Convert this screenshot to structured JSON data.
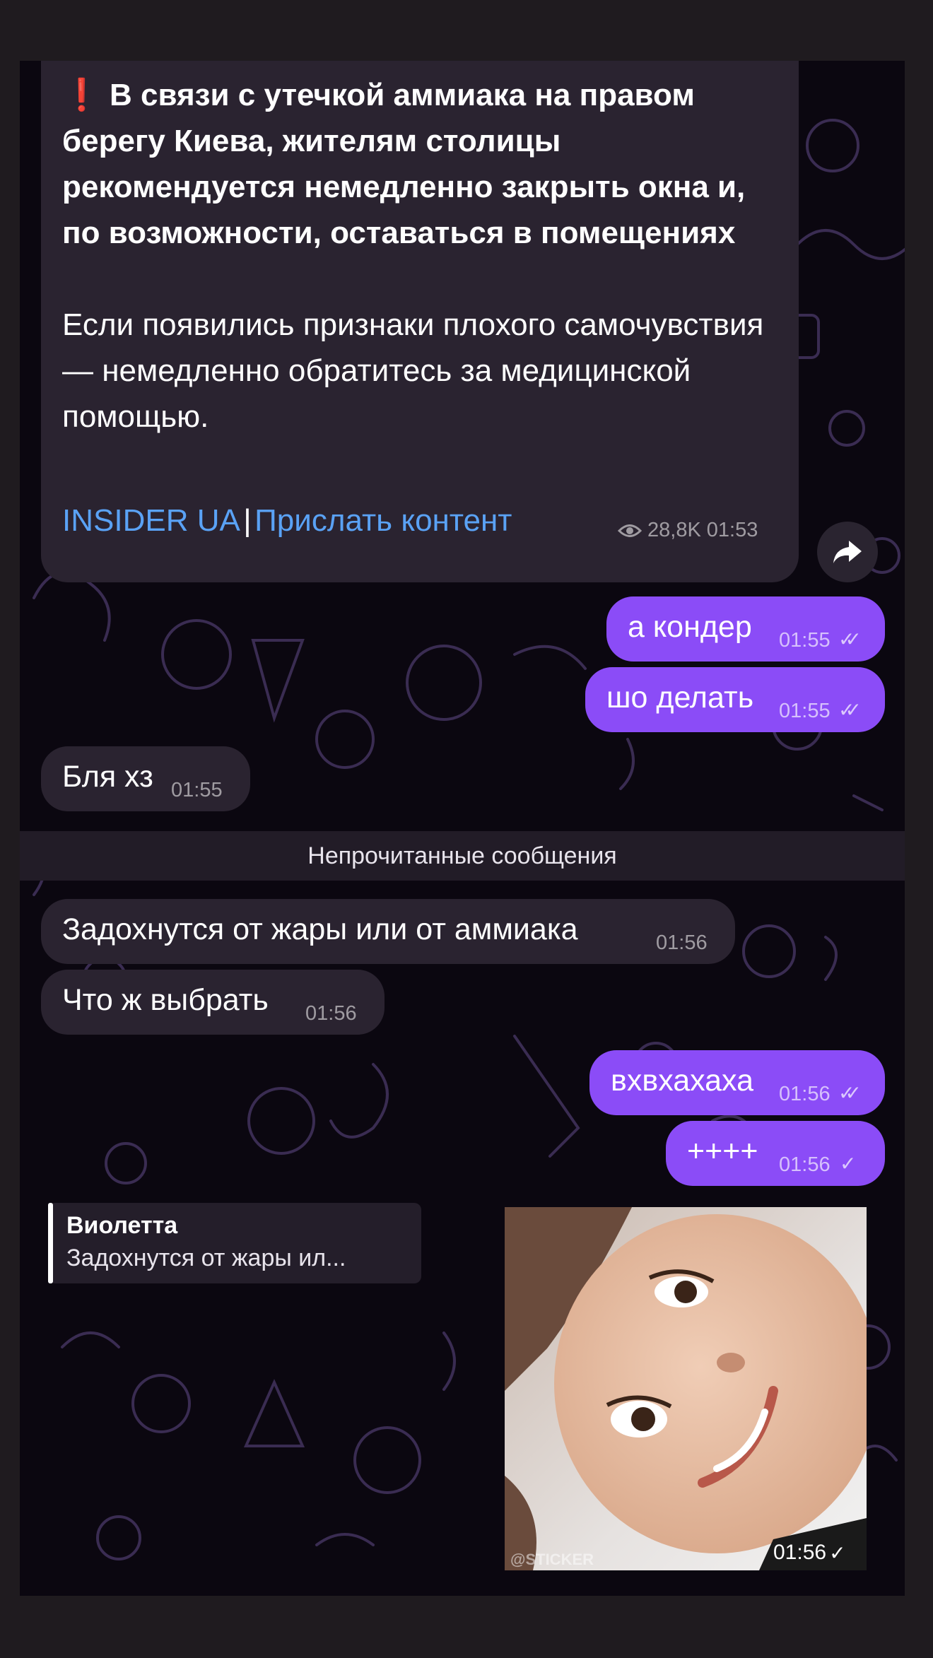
{
  "post": {
    "headline": "В связи с утечкой аммиака на правом берегу Киева, жителям столицы рекомендуется немедленно закрыть окна и, по возможности, оставаться в помещениях",
    "body": "Если появились признаки плохого самочувствия — немедленно обратитесь за медицинской помощью.",
    "link1": "INSIDER UA",
    "separator": "|",
    "link2": "Прислать контент",
    "views": "28,8K",
    "time": "01:53"
  },
  "messages": [
    {
      "text": "а кондер",
      "time": "01:55",
      "dir": "out",
      "status": "read"
    },
    {
      "text": "шо делать",
      "time": "01:55",
      "dir": "out",
      "status": "read"
    },
    {
      "text": "Бля хз",
      "time": "01:55",
      "dir": "in"
    },
    {
      "text": "Задохнутся от жары или от аммиака",
      "time": "01:56",
      "dir": "in"
    },
    {
      "text": "Что ж выбрать",
      "time": "01:56",
      "dir": "in"
    },
    {
      "text": "вхвхахаха",
      "time": "01:56",
      "dir": "out",
      "status": "read"
    },
    {
      "text": "++++",
      "time": "01:56",
      "dir": "out",
      "status": "sent"
    }
  ],
  "unread_label": "Непрочитанные сообщения",
  "reply": {
    "author": "Виолетта",
    "snippet": "Задохнутся от жары ил..."
  },
  "sticker": {
    "time": "01:56",
    "watermark": "@STICKER"
  },
  "colors": {
    "outgoing": "#8b4cf7",
    "incoming": "#2a2330",
    "link": "#5aa2f5",
    "background": "#0b0710"
  }
}
